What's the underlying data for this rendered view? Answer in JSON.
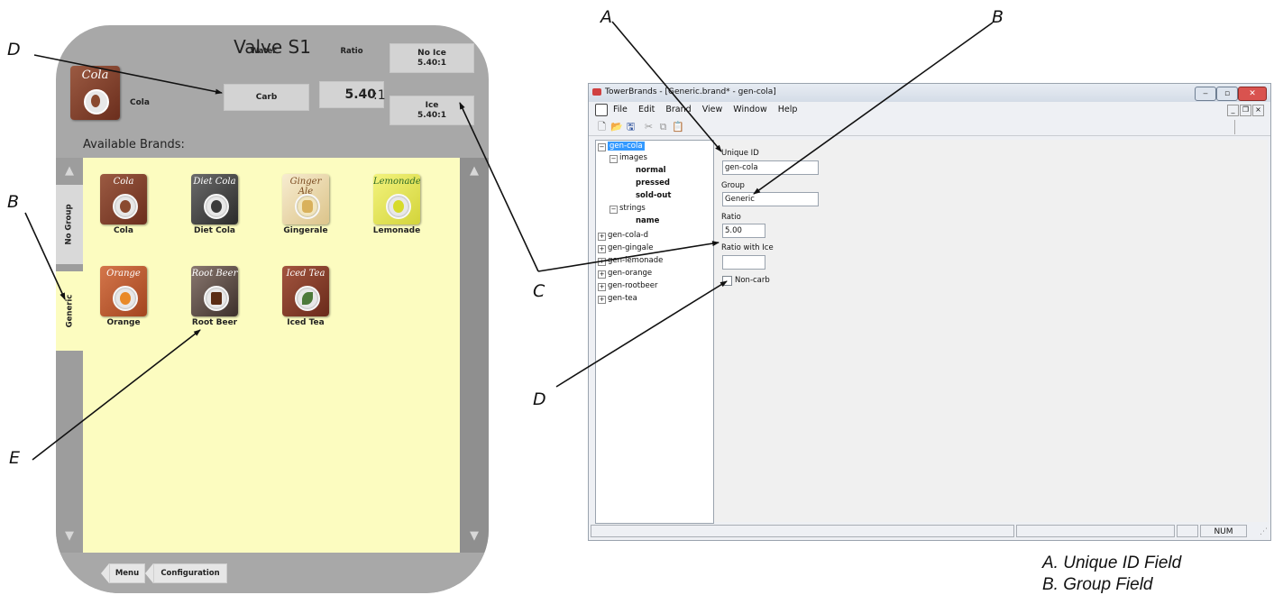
{
  "callouts": {
    "left_d": "D",
    "left_b": "B",
    "left_e": "E",
    "top_a": "A",
    "top_b": "B",
    "mid_c": "C",
    "mid_d": "D"
  },
  "legend": {
    "line1": "A. Unique ID Field",
    "line2": "B. Group Field"
  },
  "device": {
    "title": "Valve S1",
    "current_brand": {
      "name": "Cola",
      "script": "Cola"
    },
    "water_label": "Water",
    "water_value": "Carb",
    "ratio_label": "Ratio",
    "ratio_value": "5.40",
    "ratio_suffix": ":1",
    "no_ice_line1": "No Ice",
    "no_ice_line2": "5.40:1",
    "ice_line1": "Ice",
    "ice_line2": "5.40:1",
    "available_label": "Available Brands:",
    "tabs": {
      "no_group": "No Group",
      "generic": "Generic"
    },
    "up_arrow": "▲",
    "down_arrow": "▼",
    "brands": [
      {
        "name": "Cola",
        "script": "Cola",
        "color": "#7a3a26"
      },
      {
        "name": "Diet Cola",
        "script": "Diet Cola",
        "color": "#3f3f3f"
      },
      {
        "name": "Gingerale",
        "script": "Ginger Ale",
        "color": "#efe1b6"
      },
      {
        "name": "Lemonade",
        "script": "Lemonade",
        "color": "#e9ea63"
      },
      {
        "name": "Orange",
        "script": "Orange",
        "color": "#b8562b"
      },
      {
        "name": "Root Beer",
        "script": "Root Beer",
        "color": "#5a4b45"
      },
      {
        "name": "Iced Tea",
        "script": "Iced Tea",
        "color": "#7a3526"
      }
    ],
    "nav": {
      "menu": "Menu",
      "configuration": "Configuration"
    }
  },
  "app": {
    "title": "TowerBrands - [Generic.brand* - gen-cola]",
    "menu": [
      "File",
      "Edit",
      "Brand",
      "View",
      "Window",
      "Help"
    ],
    "tree": {
      "root": "gen-cola",
      "images": "images",
      "normal": "normal",
      "pressed": "pressed",
      "sold_out": "sold-out",
      "strings": "strings",
      "name": "name",
      "others": [
        "gen-cola-d",
        "gen-gingale",
        "gen-lemonade",
        "gen-orange",
        "gen-rootbeer",
        "gen-tea"
      ]
    },
    "form": {
      "unique_id_label": "Unique ID",
      "unique_id_value": "gen-cola",
      "group_label": "Group",
      "group_value": "Generic",
      "ratio_label": "Ratio",
      "ratio_value": "5.00",
      "ratio_ice_label": "Ratio with Ice",
      "ratio_ice_value": "",
      "noncarb_label": "Non-carb",
      "noncarb_checked": false
    },
    "status": {
      "num": "NUM"
    }
  }
}
